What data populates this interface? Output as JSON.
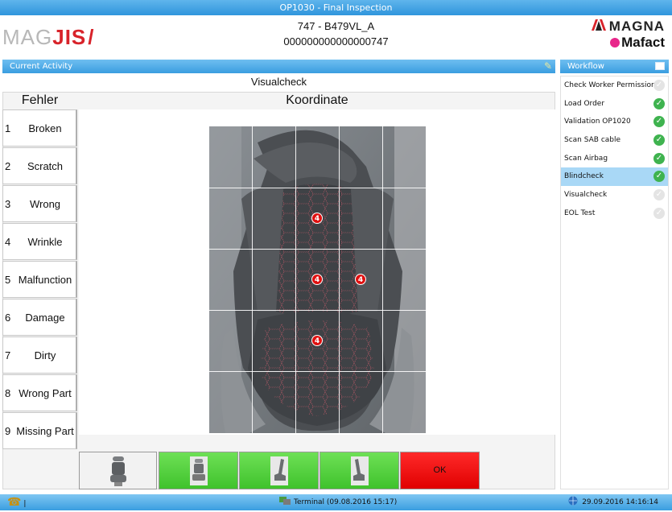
{
  "window": {
    "title": "OP1030 - Final Inspection"
  },
  "header": {
    "brand_left_prefix": "MAG",
    "brand_left_suffix": "JIS",
    "brand_left_slash": "/",
    "order_line1": "747 - B479VL_A",
    "order_line2": "000000000000000747",
    "brand_right_top": "MAGNA",
    "brand_right_bottom": "Mafact"
  },
  "current_activity": {
    "label": "Current Activity",
    "name": "Visualcheck"
  },
  "columns": {
    "fehler": "Fehler",
    "koordinate": "Koordinate"
  },
  "errors": [
    {
      "num": "1",
      "label": "Broken Seam"
    },
    {
      "num": "2",
      "label": "Scratch"
    },
    {
      "num": "3",
      "label": "Wrong"
    },
    {
      "num": "4",
      "label": "Wrinkle"
    },
    {
      "num": "5",
      "label": "Malfunction"
    },
    {
      "num": "6",
      "label": "Damage"
    },
    {
      "num": "7",
      "label": "Dirty"
    },
    {
      "num": "8",
      "label": "Wrong Part"
    },
    {
      "num": "9",
      "label": "Missing Part"
    }
  ],
  "markers": [
    {
      "label": "4"
    },
    {
      "label": "4"
    },
    {
      "label": "4"
    },
    {
      "label": "4"
    }
  ],
  "bottom_buttons": {
    "ok_label": "OK"
  },
  "workflow": {
    "label": "Workflow",
    "items": [
      {
        "label": "Check Worker Permission",
        "status": "pending"
      },
      {
        "label": "Load Order",
        "status": "done"
      },
      {
        "label": "Validation OP1020",
        "status": "done"
      },
      {
        "label": "Scan SAB cable",
        "status": "done"
      },
      {
        "label": "Scan Airbag",
        "status": "done"
      },
      {
        "label": "Blindcheck",
        "status": "done",
        "active": true
      },
      {
        "label": "Visualcheck",
        "status": "pending"
      },
      {
        "label": "EOL Test",
        "status": "pending"
      }
    ]
  },
  "statusbar": {
    "left_text": "|",
    "terminal_text": "Terminal  (09.08.2016 15:17)",
    "datetime": "29.09.2016 14:16:14"
  },
  "colors": {
    "accent": "#3a9ee0",
    "ok_red": "#e00000",
    "green": "#3fc22c",
    "brand_red": "#d8232a"
  },
  "icons": {
    "seat_views": [
      "seat-front-icon",
      "seat-front-icon",
      "seat-side-left-icon",
      "seat-side-right-icon"
    ],
    "edit": "pencil-icon",
    "workflow": "list-icon",
    "status_phone": "phone-icon",
    "terminal": "terminal-icon",
    "globe": "globe-icon"
  }
}
